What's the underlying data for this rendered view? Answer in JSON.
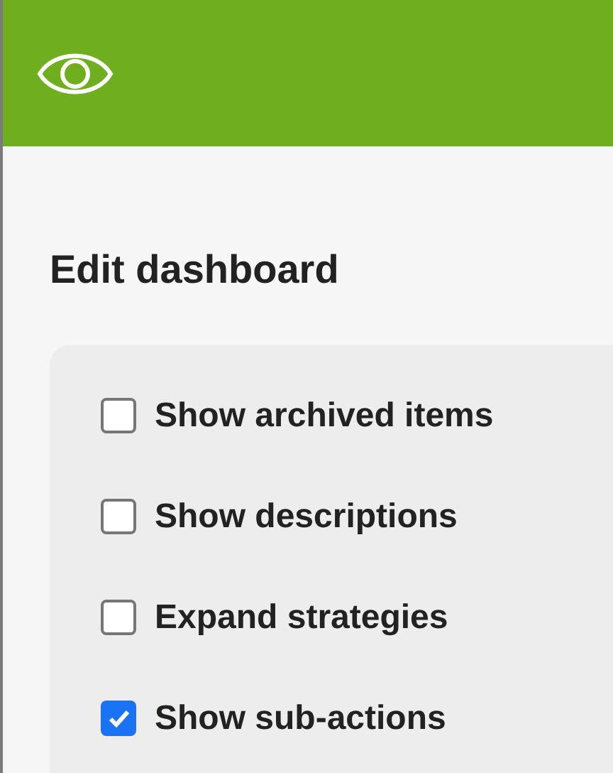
{
  "title": "Edit dashboard",
  "options": [
    {
      "label": "Show archived items",
      "checked": false
    },
    {
      "label": "Show descriptions",
      "checked": false
    },
    {
      "label": "Expand strategies",
      "checked": false
    },
    {
      "label": "Show sub-actions",
      "checked": true
    }
  ]
}
